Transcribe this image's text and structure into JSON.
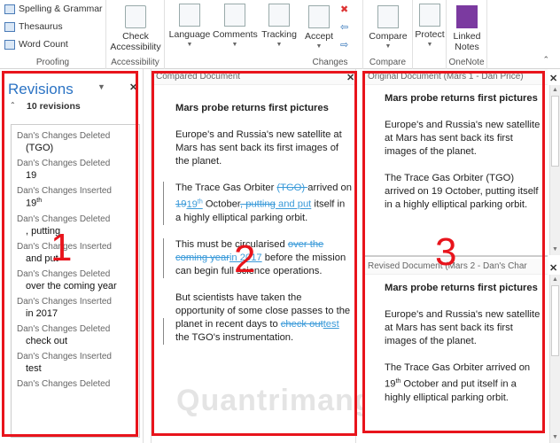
{
  "ribbon": {
    "proofing": {
      "label": "Proofing",
      "items": [
        "Spelling & Grammar",
        "Thesaurus",
        "Word Count"
      ]
    },
    "accessibility": {
      "label": "Accessibility",
      "button": "Check Accessibility"
    },
    "language": "Language",
    "comments": "Comments",
    "tracking": "Tracking",
    "changes": {
      "label": "Changes",
      "accept": "Accept"
    },
    "compare": {
      "label": "Compare",
      "button": "Compare"
    },
    "protect": "Protect",
    "onenote": {
      "label": "OneNote",
      "button": "Linked Notes"
    }
  },
  "revisions": {
    "title": "Revisions",
    "count": "10 revisions",
    "items": [
      {
        "author": "Dan's Changes Deleted",
        "text": "(TGO)"
      },
      {
        "author": "Dan's Changes Deleted",
        "text": "19"
      },
      {
        "author": "Dan's Changes Inserted",
        "text": "19",
        "sup": "th"
      },
      {
        "author": "Dan's Changes Deleted",
        "text": ", putting"
      },
      {
        "author": "Dan's Changes Inserted",
        "text": " and put"
      },
      {
        "author": "Dan's Changes Deleted",
        "text": "over the coming year"
      },
      {
        "author": "Dan's Changes Inserted",
        "text": "in 2017"
      },
      {
        "author": "Dan's Changes Deleted",
        "text": "check out"
      },
      {
        "author": "Dan's Changes Inserted",
        "text": "test"
      },
      {
        "author": "Dan's Changes Deleted",
        "text": ""
      }
    ]
  },
  "compared": {
    "header": "Compared Document",
    "title": "Mars probe returns first pictures",
    "p1": "Europe's and Russia's new satellite at Mars has sent back its first images of the planet.",
    "p2": {
      "a": "The Trace Gas Orbiter ",
      "d1": "(TGO) ",
      "b": "arrived on ",
      "d2": "19",
      "i2": "19",
      "i2sup": "th",
      "c": " October",
      "d3": ", putting",
      "i3": " and put",
      "e": " itself in a highly elliptical parking orbit."
    },
    "p3": {
      "a": "This must be circularised ",
      "d": "over the coming year",
      "i": "in 2017",
      "b": " before the mission can begin full science operations."
    },
    "p4": {
      "a": "But scientists have taken the opportunity of some close passes to the planet in recent days to ",
      "d": "check out",
      "i": "test",
      "b": " the TGO's instrumentation."
    }
  },
  "original": {
    "header": "Original Document (Mars 1 - Dan Price)",
    "title": "Mars probe returns first pictures",
    "p1": "Europe's and Russia's new satellite at Mars has sent back its first images of the planet.",
    "p2": "The Trace Gas Orbiter (TGO) arrived on 19 October, putting itself in a highly elliptical parking orbit."
  },
  "revised": {
    "header": "Revised Document (Mars 2 - Dan's Char",
    "title": "Mars probe returns first pictures",
    "p1": "Europe's and Russia's new satellite at Mars has sent back its first images of the planet.",
    "p2a": "The Trace Gas Orbiter arrived on 19",
    "p2sup": "th",
    "p2b": " October and put itself in a highly elliptical parking orbit."
  },
  "annotations": [
    "1",
    "2",
    "3"
  ],
  "watermark": "Quantrimang"
}
